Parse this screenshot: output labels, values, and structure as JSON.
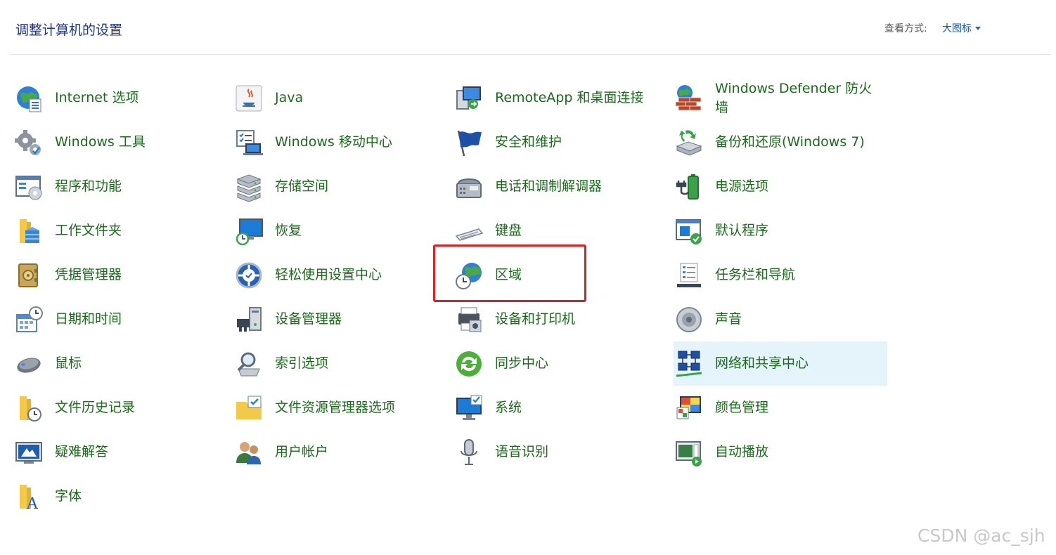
{
  "header": {
    "title": "调整计算机的设置",
    "view_label": "查看方式:",
    "view_value": "大图标"
  },
  "items": [
    {
      "label": "Internet 选项",
      "icon": "globe-icon"
    },
    {
      "label": "Windows 工具",
      "icon": "gears-icon"
    },
    {
      "label": "程序和功能",
      "icon": "programs-icon"
    },
    {
      "label": "工作文件夹",
      "icon": "work-folder-icon"
    },
    {
      "label": "凭据管理器",
      "icon": "vault-icon"
    },
    {
      "label": "日期和时间",
      "icon": "calendar-clock-icon"
    },
    {
      "label": "鼠标",
      "icon": "mouse-icon"
    },
    {
      "label": "文件历史记录",
      "icon": "folder-history-icon"
    },
    {
      "label": "疑难解答",
      "icon": "troubleshoot-icon"
    },
    {
      "label": "字体",
      "icon": "font-folder-icon"
    },
    {
      "label": "Java",
      "icon": "java-icon"
    },
    {
      "label": "Windows 移动中心",
      "icon": "mobility-center-icon"
    },
    {
      "label": "存储空间",
      "icon": "storage-icon"
    },
    {
      "label": "恢复",
      "icon": "recovery-icon"
    },
    {
      "label": "轻松使用设置中心",
      "icon": "ease-of-access-icon"
    },
    {
      "label": "设备管理器",
      "icon": "device-manager-icon"
    },
    {
      "label": "索引选项",
      "icon": "indexing-icon"
    },
    {
      "label": "文件资源管理器选项",
      "icon": "folder-options-icon"
    },
    {
      "label": "用户帐户",
      "icon": "users-icon"
    },
    {
      "label": "RemoteApp 和桌面连接",
      "icon": "remote-desktop-icon"
    },
    {
      "label": "安全和维护",
      "icon": "flag-icon"
    },
    {
      "label": "电话和调制解调器",
      "icon": "phone-icon"
    },
    {
      "label": "键盘",
      "icon": "keyboard-icon"
    },
    {
      "label": "区域",
      "icon": "region-globe-clock-icon"
    },
    {
      "label": "设备和打印机",
      "icon": "printer-icon"
    },
    {
      "label": "同步中心",
      "icon": "sync-icon"
    },
    {
      "label": "系统",
      "icon": "system-monitor-icon"
    },
    {
      "label": "语音识别",
      "icon": "microphone-icon"
    },
    {
      "label": "Windows Defender 防火墙",
      "icon": "firewall-icon"
    },
    {
      "label": "备份和还原(Windows 7)",
      "icon": "backup-icon"
    },
    {
      "label": "电源选项",
      "icon": "power-battery-icon"
    },
    {
      "label": "默认程序",
      "icon": "default-programs-icon"
    },
    {
      "label": "任务栏和导航",
      "icon": "taskbar-icon"
    },
    {
      "label": "声音",
      "icon": "speaker-icon"
    },
    {
      "label": "网络和共享中心",
      "icon": "network-icon"
    },
    {
      "label": "颜色管理",
      "icon": "color-management-icon"
    },
    {
      "label": "自动播放",
      "icon": "autoplay-icon"
    }
  ],
  "watermark": "CSDN @ac_sjh",
  "colors": {
    "title": "#1e3287",
    "link": "#1a6b1a",
    "hover_bg": "#e5f3fb",
    "highlight": "#e02020"
  }
}
